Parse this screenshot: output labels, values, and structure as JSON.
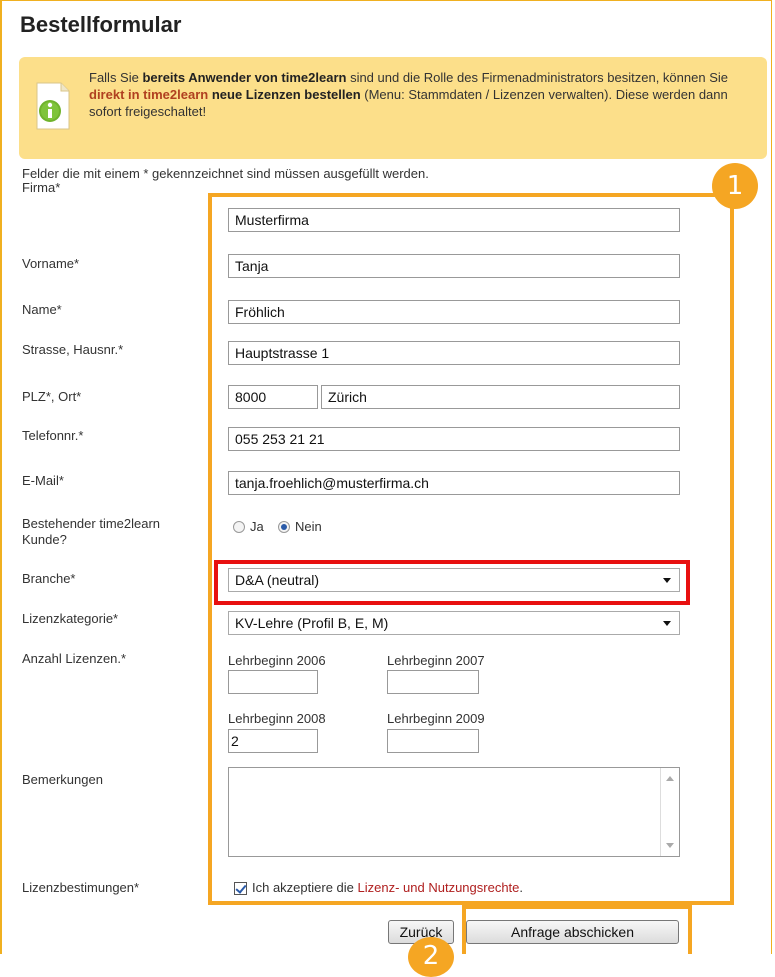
{
  "title": "Bestellformular",
  "info": {
    "t1": "Falls Sie ",
    "b1": "bereits Anwender von time2learn",
    "t2": " sind und die Rolle des Firmenadministrators besitzen, können Sie ",
    "h1": "direkt in time2learn",
    "b2": " neue Lizenzen bestellen",
    "t3": " (Menu: Stammdaten / Lizenzen verwalten). Diese werden dann sofort freigeschaltet!"
  },
  "note": "Felder die mit einem * gekennzeichnet sind müssen ausgefüllt werden.",
  "labels": {
    "firma": "Firma*",
    "vorname": "Vorname*",
    "name": "Name*",
    "strasse": "Strasse, Hausnr.*",
    "plz_ort": "PLZ*, Ort*",
    "telefon": "Telefonnr.*",
    "email": "E-Mail*",
    "kunde_line1": "Bestehender time2learn",
    "kunde_line2": "Kunde?",
    "branche": "Branche*",
    "kategorie": "Lizenzkategorie*",
    "anzahl": "Anzahl Lizenzen.*",
    "bemerkungen": "Bemerkungen",
    "bestimmungen": "Lizenzbestimungen*"
  },
  "values": {
    "firma": "Musterfirma",
    "vorname": "Tanja",
    "name": "Fröhlich",
    "strasse": "Hauptstrasse 1",
    "plz": "8000",
    "ort": "Zürich",
    "telefon": "055 253 21 21",
    "email": "tanja.froehlich@musterfirma.ch",
    "branche": "D&A (neutral)",
    "kategorie": "KV-Lehre (Profil B, E, M)"
  },
  "radio": {
    "ja": "Ja",
    "nein": "Nein",
    "selected": "Nein"
  },
  "lehrbeginn": [
    {
      "label": "Lehrbeginn 2006",
      "value": ""
    },
    {
      "label": "Lehrbeginn 2007",
      "value": ""
    },
    {
      "label": "Lehrbeginn 2008",
      "value": "2"
    },
    {
      "label": "Lehrbeginn 2009",
      "value": ""
    }
  ],
  "agree": {
    "prefix": "Ich akzeptiere die ",
    "link": "Lizenz- und Nutzungsrechte",
    "suffix": ".",
    "checked": true
  },
  "buttons": {
    "back": "Zurück",
    "submit": "Anfrage abschicken"
  },
  "badges": {
    "one": "1",
    "two": "2"
  },
  "colors": {
    "accent": "#f5a623",
    "highlight": "#e81010",
    "info_bg": "#fcdf8a",
    "link": "#b02020"
  }
}
